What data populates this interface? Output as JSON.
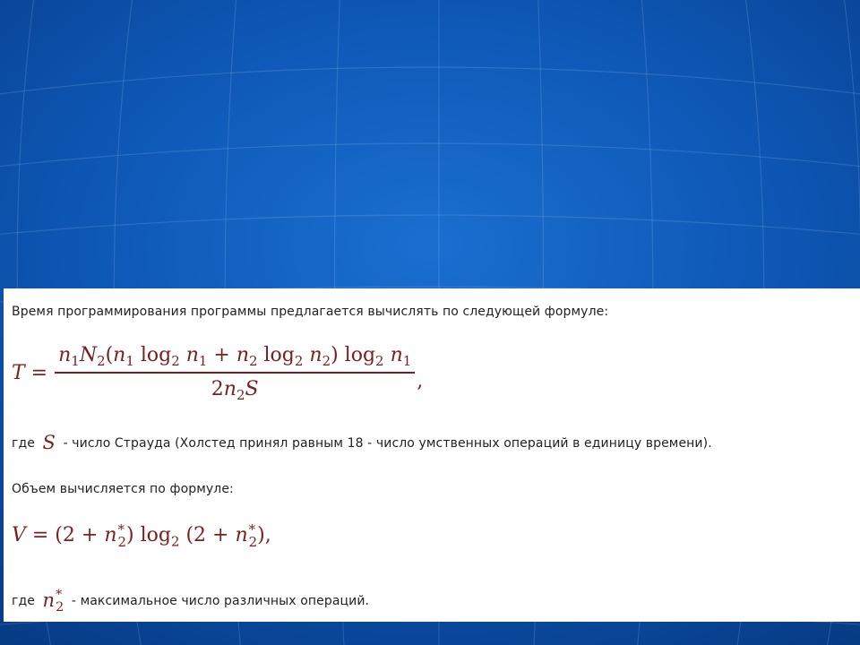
{
  "text": {
    "intro": "Время программирования программы предлагается вычислять по следующей формуле:",
    "where_prefix_1": "где",
    "where_rest_1": "- число Страуда (Холстед принял равным 18 - число умственных операций в единицу времени).",
    "volume_intro": "Объем вычисляется по формуле:",
    "where_prefix_2": "где",
    "where_rest_2": "- максимальное число различных операций."
  },
  "formula_T": {
    "lhs": "T =",
    "numerator": "n₁N₂(n₁ log₂ n₁ + n₂ log₂ n₂) log₂ n₁",
    "denominator": "2n₂S",
    "trailing": ","
  },
  "formula_V": "V = (2 + n₂*) log₂ (2 + n₂*),",
  "symbol_S": "S",
  "symbol_n2star": "n₂*",
  "colors": {
    "math": "#7a1e1e",
    "text": "#222222",
    "background_blue": "#0d56b3"
  }
}
